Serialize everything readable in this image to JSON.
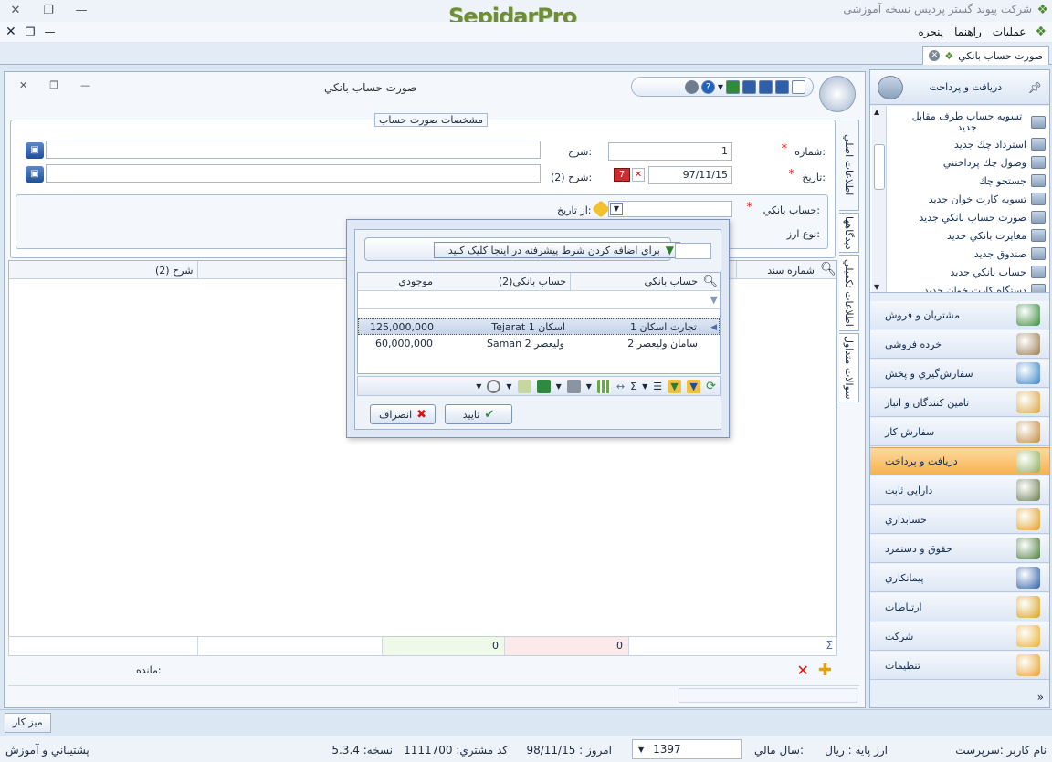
{
  "app": {
    "title": "شرکت پیوند گستر پردیس نسخه آموزشی",
    "brand": "SepidarPro"
  },
  "menu": {
    "items": [
      "عملیات",
      "راهنما",
      "پنجره"
    ]
  },
  "doc_tab": {
    "label": "صورت حساب بانکي"
  },
  "form": {
    "title": "صورت حساب بانکي",
    "group_title": "مشخصات صورت حساب",
    "number_label": "شماره:",
    "number_value": "1",
    "date_label": "تاريخ:",
    "date_value": "97/11/15",
    "desc_label": "شرح:",
    "desc2_label": "شرح (2):",
    "bank_label": "حساب بانکي:",
    "from_date_label": "از تاريخ:",
    "currency_label": "نوع ارز:",
    "vtabs": [
      "اطلاعات اصلي",
      "ديدگاهها",
      "اطلاعات تکميلي",
      "سوالات متداول"
    ],
    "grid_cols": [
      "شماره سند",
      "شرح (2)"
    ],
    "sum_values": [
      "0",
      "0"
    ],
    "remaining_label": "مانده:"
  },
  "popup": {
    "filter_text": "براي اضافه کردن شرط پيشرفته در اينجا کليک کنيد",
    "columns": [
      "حساب بانکي",
      "حساب بانکي(2)",
      "موجودي"
    ],
    "rows": [
      {
        "bank": "تجارت اسکان 1",
        "bank2": "Tejarat اسکان 1",
        "balance": "125,000,000"
      },
      {
        "bank": "سامان وليعصر 2",
        "bank2": "Saman وليعصر 2",
        "balance": "60,000,000"
      }
    ],
    "ok_label": "تاييد",
    "cancel_label": "انصراف"
  },
  "sidebar": {
    "header": "دريافت و پرداخت",
    "items": [
      "تسويه حساب طرف مقابل جديد",
      "استرداد چك جديد",
      "وصول چك پرداختني",
      "جستجو چك",
      "تسويه کارت خوان جديد",
      "صورت حساب بانکي جديد",
      "مغايرت بانکي جديد",
      "صندوق جديد",
      "حساب بانکي جديد",
      "دستگاه کارت خوان جديد"
    ],
    "modules": [
      "مشتريان و فروش",
      "خرده فروشي",
      "سفارش‌گيري و پخش",
      "تامين کنندگان و انبار",
      "سفارش کار",
      "دريافت و پرداخت",
      "دارايي ثابت",
      "حسابداري",
      "حقوق و دستمزد",
      "پيمانكاري",
      "ارتباطات",
      "شرکت",
      "تنظيمات"
    ],
    "active_module": "دريافت و پرداخت",
    "module_colors": [
      "#3b8a3e",
      "#9b7b52",
      "#3a84c9",
      "#d9a441",
      "#c08a3e",
      "#8fae5a",
      "#6a7b50",
      "#e0a020",
      "#4a7a3a",
      "#2d5fa8",
      "#d6a21a",
      "#e8b030",
      "#e6a22a"
    ]
  },
  "taskbar": {
    "desk_label": "ميز كار"
  },
  "status": {
    "user": "نام كاربر :سرپرست",
    "base_currency": "ارز پايه :  ريال",
    "fiscal_year_label": "سال مالي:",
    "fiscal_year": "1397",
    "today": "امروز :   98/11/15",
    "customer_code": "كد مشتري:   1111700",
    "version": "نسخه:   5.3.4",
    "support": "پشتيباني و آموزش"
  }
}
